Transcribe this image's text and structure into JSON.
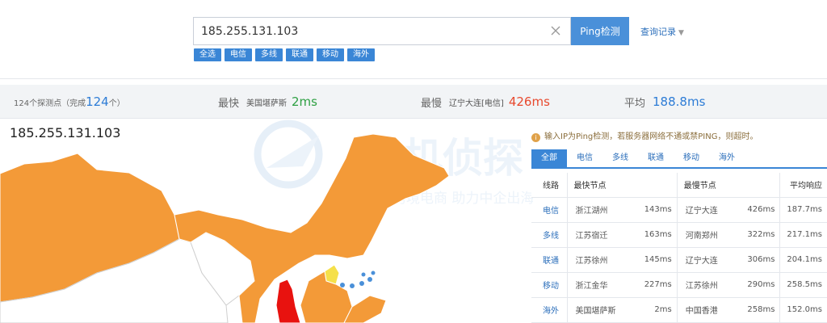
{
  "search": {
    "value": "185.255.131.103",
    "clear_icon": "close-icon",
    "button_label": "Ping检测",
    "history_label": "查询记录"
  },
  "filters": [
    "全选",
    "电信",
    "多线",
    "联通",
    "移动",
    "海外"
  ],
  "stats": {
    "probes_prefix": "124个探测点（完成",
    "probes_done": "124",
    "probes_suffix": "个）",
    "fastest_label": "最快",
    "fastest_location": "美国堪萨斯",
    "fastest_value": "2ms",
    "slowest_label": "最慢",
    "slowest_location": "辽宁大连[电信]",
    "slowest_value": "426ms",
    "average_label": "平均",
    "average_value": "188.8ms"
  },
  "map": {
    "ip": "185.255.131.103",
    "watermark_title": "主机侦探",
    "watermark_slogan": "服务跨境电商 助力中企出海",
    "colors": {
      "orange": "#f39a38",
      "red": "#e8120f",
      "yellow": "#f5e04a",
      "white": "#ffffff"
    }
  },
  "notice": "输入IP为Ping检测，若服务器网络不通或禁PING，则超时。",
  "tabs": [
    "全部",
    "电信",
    "多线",
    "联通",
    "移动",
    "海外"
  ],
  "table": {
    "headers": [
      "线路",
      "最快节点",
      "最慢节点",
      "平均响应"
    ],
    "rows": [
      {
        "line": "电信",
        "fast_node": "浙江湖州",
        "fast_ms": "143ms",
        "slow_node": "辽宁大连",
        "slow_ms": "426ms",
        "avg": "187.7ms"
      },
      {
        "line": "多线",
        "fast_node": "江苏宿迁",
        "fast_ms": "163ms",
        "slow_node": "河南郑州",
        "slow_ms": "322ms",
        "avg": "217.1ms"
      },
      {
        "line": "联通",
        "fast_node": "江苏徐州",
        "fast_ms": "145ms",
        "slow_node": "辽宁大连",
        "slow_ms": "306ms",
        "avg": "204.1ms"
      },
      {
        "line": "移动",
        "fast_node": "浙江金华",
        "fast_ms": "227ms",
        "slow_node": "江苏徐州",
        "slow_ms": "290ms",
        "avg": "258.5ms"
      },
      {
        "line": "海外",
        "fast_node": "美国堪萨斯",
        "fast_ms": "2ms",
        "slow_node": "中国香港",
        "slow_ms": "258ms",
        "avg": "152.0ms"
      }
    ]
  }
}
